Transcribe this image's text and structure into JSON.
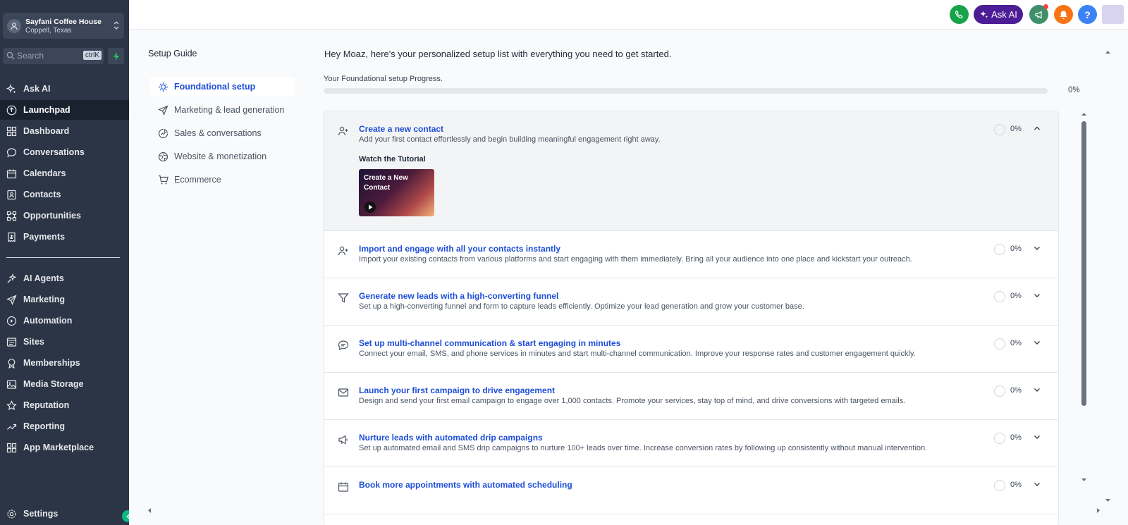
{
  "account": {
    "name": "Sayfani Coffee House",
    "location": "Coppell, Texas"
  },
  "search": {
    "placeholder": "Search",
    "shortcut": "ctrlK"
  },
  "sidebar": {
    "items": [
      {
        "label": "Ask AI",
        "icon": "sparkle-icon"
      },
      {
        "label": "Launchpad",
        "icon": "rocket-icon"
      },
      {
        "label": "Dashboard",
        "icon": "grid-icon"
      },
      {
        "label": "Conversations",
        "icon": "chat-icon"
      },
      {
        "label": "Calendars",
        "icon": "calendar-icon"
      },
      {
        "label": "Contacts",
        "icon": "contact-card-icon"
      },
      {
        "label": "Opportunities",
        "icon": "nodes-icon"
      },
      {
        "label": "Payments",
        "icon": "receipt-icon"
      },
      {
        "label": "AI Agents",
        "icon": "ai-agents-icon"
      },
      {
        "label": "Marketing",
        "icon": "send-icon"
      },
      {
        "label": "Automation",
        "icon": "automation-icon"
      },
      {
        "label": "Sites",
        "icon": "sites-icon"
      },
      {
        "label": "Memberships",
        "icon": "membership-icon"
      },
      {
        "label": "Media Storage",
        "icon": "image-icon"
      },
      {
        "label": "Reputation",
        "icon": "star-icon"
      },
      {
        "label": "Reporting",
        "icon": "trend-icon"
      },
      {
        "label": "App Marketplace",
        "icon": "apps-icon"
      }
    ],
    "active": "Launchpad",
    "settings_label": "Settings"
  },
  "topbar": {
    "ask_ai_label": "Ask AI",
    "help_label": "?"
  },
  "guide": {
    "title": "Setup Guide",
    "categories": [
      {
        "label": "Foundational setup",
        "icon": "sun-icon"
      },
      {
        "label": "Marketing & lead generation",
        "icon": "send-icon"
      },
      {
        "label": "Sales & conversations",
        "icon": "chart-icon"
      },
      {
        "label": "Website & monetization",
        "icon": "globe-icon"
      },
      {
        "label": "Ecommerce",
        "icon": "cart-icon"
      }
    ],
    "active_category": "Foundational setup",
    "greeting": "Hey Moaz, here's your personalized setup list with everything you need to get started.",
    "progress_label": "Your Foundational setup Progress.",
    "progress_value": 0,
    "progress_text": "0%"
  },
  "tasks": [
    {
      "title": "Create a new contact",
      "description": "Add your first contact effortlessly and begin building meaningful engagement right away.",
      "percent": "0%",
      "expanded": true,
      "watch_label": "Watch the Tutorial",
      "video_title": "Create a New Contact"
    },
    {
      "title": "Import and engage with all your contacts instantly",
      "description": "Import your existing contacts from various platforms and start engaging with them immediately. Bring all your audience into one place and kickstart your outreach.",
      "percent": "0%"
    },
    {
      "title": "Generate new leads with a high-converting funnel",
      "description": "Set up a high-converting funnel and form to capture leads efficiently. Optimize your lead generation and grow your customer base.",
      "percent": "0%"
    },
    {
      "title": "Set up multi-channel communication & start engaging in minutes",
      "description": "Connect your email, SMS, and phone services in minutes and start multi-channel communication. Improve your response rates and customer engagement quickly.",
      "percent": "0%"
    },
    {
      "title": "Launch your first campaign to drive engagement",
      "description": "Design and send your first email campaign to engage over 1,000 contacts. Promote your services, stay top of mind, and drive conversions with targeted emails.",
      "percent": "0%"
    },
    {
      "title": "Nurture leads with automated drip campaigns",
      "description": "Set up automated email and SMS drip campaigns to nurture 100+ leads over time. Increase conversion rates by following up consistently without manual intervention.",
      "percent": "0%"
    },
    {
      "title": "Book more appointments with automated scheduling",
      "description": "",
      "percent": "0%"
    }
  ]
}
